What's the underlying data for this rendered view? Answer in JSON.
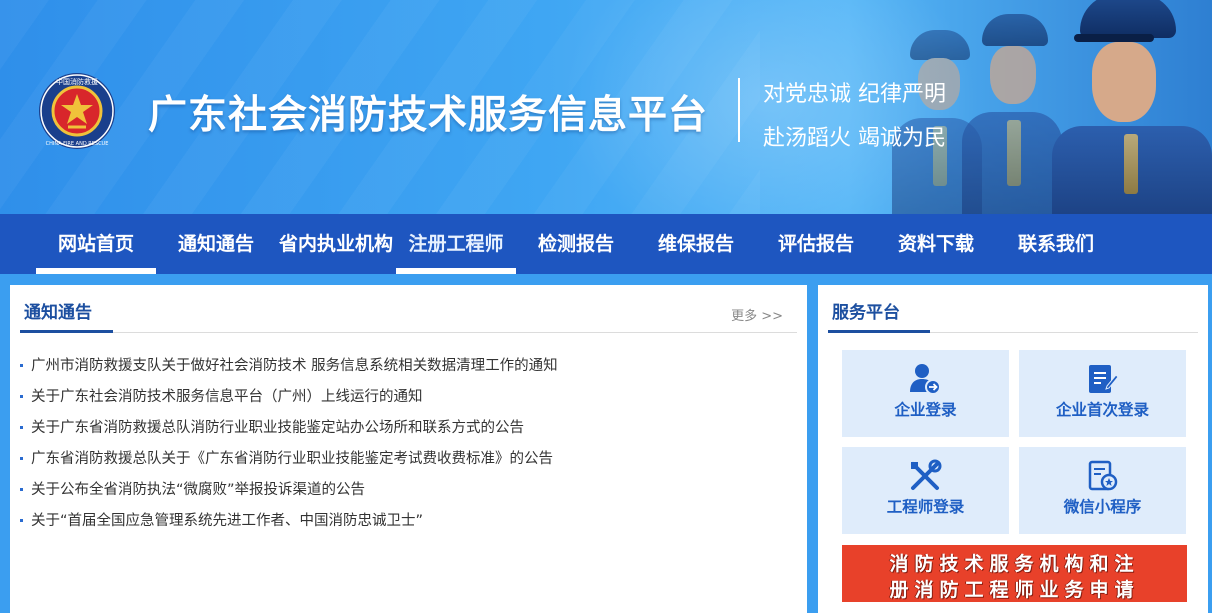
{
  "header": {
    "logo_text": "中国消防救援 CHINA FIRE AND RESCUE",
    "title": "广东社会消防技术服务信息平台",
    "slogan_line1": "对党忠诚 纪律严明",
    "slogan_line2": "赴汤蹈火 竭诚为民"
  },
  "nav": {
    "items": [
      {
        "label": "网站首页",
        "active": true
      },
      {
        "label": "通知通告",
        "active": false
      },
      {
        "label": "省内执业机构",
        "active": false
      },
      {
        "label": "注册工程师",
        "active": true
      },
      {
        "label": "检测报告",
        "active": false
      },
      {
        "label": "维保报告",
        "active": false
      },
      {
        "label": "评估报告",
        "active": false
      },
      {
        "label": "资料下载",
        "active": false
      },
      {
        "label": "联系我们",
        "active": false
      }
    ]
  },
  "notices": {
    "title": "通知通告",
    "more": "更多 >>",
    "items": [
      "广州市消防救援支队关于做好社会消防技术 服务信息系统相关数据清理工作的通知",
      "关于广东社会消防技术服务信息平台（广州）上线运行的通知",
      "关于广东省消防救援总队消防行业职业技能鉴定站办公场所和联系方式的公告",
      "广东省消防救援总队关于《广东省消防行业职业技能鉴定考试费收费标准》的公告",
      "关于公布全省消防执法“微腐败”举报投诉渠道的公告",
      "关于“首届全国应急管理系统先进工作者、中国消防忠诚卫士”"
    ]
  },
  "services": {
    "title": "服务平台",
    "tiles": [
      {
        "label": "企业登录",
        "icon": "user-login-icon"
      },
      {
        "label": "企业首次登录",
        "icon": "edit-document-icon"
      },
      {
        "label": "工程师登录",
        "icon": "tools-icon"
      },
      {
        "label": "微信小程序",
        "icon": "certificate-icon"
      }
    ],
    "promo_line1": "消防技术服务机构和注",
    "promo_line2": "册消防工程师业务申请"
  },
  "colors": {
    "nav_bg": "#1e56c0",
    "title_blue": "#1c4fa0",
    "tile_bg": "#dfecfb",
    "promo_red": "#e8412a"
  }
}
